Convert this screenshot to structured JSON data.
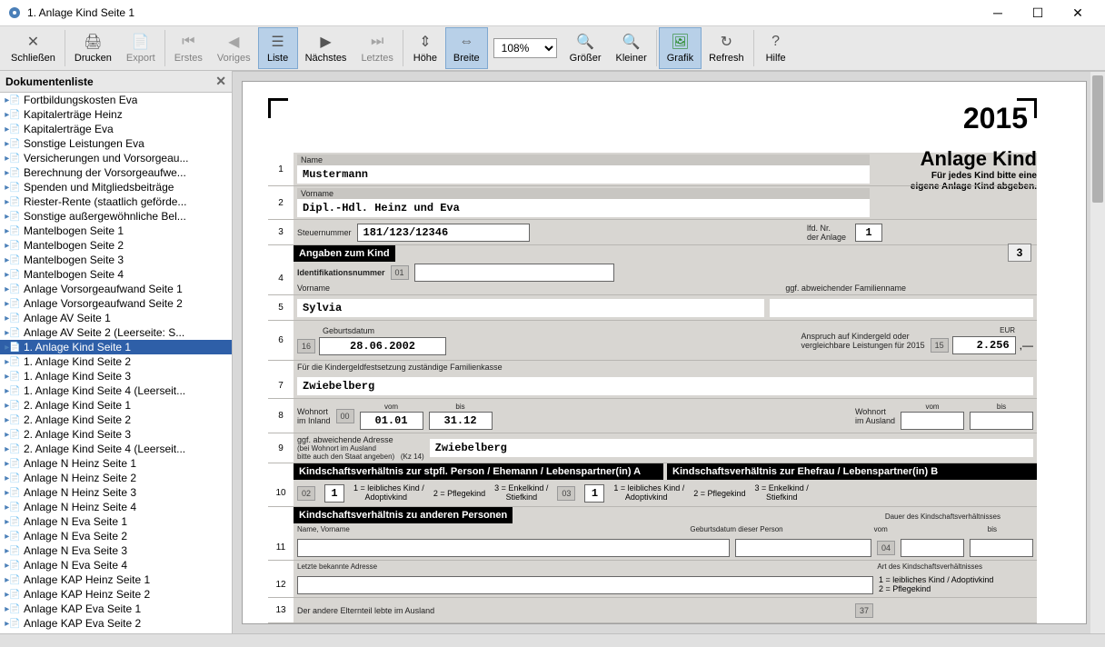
{
  "window": {
    "title": "1. Anlage Kind Seite 1"
  },
  "toolbar": {
    "schliessen": "Schließen",
    "drucken": "Drucken",
    "export": "Export",
    "erstes": "Erstes",
    "voriges": "Voriges",
    "liste": "Liste",
    "naechstes": "Nächstes",
    "letztes": "Letztes",
    "hoehe": "Höhe",
    "breite": "Breite",
    "zoom": "108%",
    "groesser": "Größer",
    "kleiner": "Kleiner",
    "grafik": "Grafik",
    "refresh": "Refresh",
    "hilfe": "Hilfe"
  },
  "sidebar": {
    "title": "Dokumentenliste",
    "items": [
      "Fortbildungskosten Eva",
      "Kapitalerträge Heinz",
      "Kapitalerträge Eva",
      "Sonstige Leistungen Eva",
      "Versicherungen und Vorsorgeau...",
      "Berechnung der Vorsorgeaufwe...",
      "Spenden und Mitgliedsbeiträge",
      "Riester-Rente (staatlich geförde...",
      "Sonstige außergewöhnliche Bel...",
      "Mantelbogen Seite 1",
      "Mantelbogen Seite 2",
      "Mantelbogen Seite 3",
      "Mantelbogen Seite 4",
      "Anlage Vorsorgeaufwand Seite 1",
      "Anlage Vorsorgeaufwand Seite 2",
      "Anlage AV Seite 1",
      "Anlage AV Seite 2 (Leerseite: S...",
      "1. Anlage Kind Seite 1",
      "1. Anlage Kind Seite 2",
      "1. Anlage Kind Seite 3",
      "1. Anlage Kind Seite 4 (Leerseit...",
      "2. Anlage Kind Seite 1",
      "2. Anlage Kind Seite 2",
      "2. Anlage Kind Seite 3",
      "2. Anlage Kind Seite 4 (Leerseit...",
      "Anlage N Heinz Seite 1",
      "Anlage N Heinz Seite 2",
      "Anlage N Heinz Seite 3",
      "Anlage N Heinz Seite 4",
      "Anlage N Eva Seite 1",
      "Anlage N Eva Seite 2",
      "Anlage N Eva Seite 3",
      "Anlage N Eva Seite 4",
      "Anlage KAP Heinz Seite 1",
      "Anlage KAP Heinz Seite 2",
      "Anlage KAP Eva Seite 1",
      "Anlage KAP Eva Seite 2"
    ],
    "selected_index": 17
  },
  "form": {
    "year": "2015",
    "title": "Anlage Kind",
    "subtitle1": "Für jedes Kind bitte eine",
    "subtitle2": "eigene Anlage Kind abgeben.",
    "name_label": "Name",
    "name": "Mustermann",
    "vorname_label": "Vorname",
    "vorname": "Dipl.-Hdl. Heinz und Eva",
    "steuernummer_label": "Steuernummer",
    "steuernummer": "181/123/12346",
    "lfd_label1": "lfd. Nr.",
    "lfd_label2": "der Anlage",
    "lfd_nr": "1",
    "box3": "3",
    "section_kind": "Angaben zum Kind",
    "ident_label": "Identifikationsnummer",
    "ident_code": "01",
    "kvorname_label": "Vorname",
    "abw_famname_label": "ggf. abweichender Familienname",
    "kind_vorname": "Sylvia",
    "gebdat_label": "Geburtsdatum",
    "gebdat_code": "16",
    "gebdat": "28.06.2002",
    "anspruch_label1": "Anspruch auf Kindergeld oder",
    "anspruch_label2": "vergleichbare Leistungen für 2015",
    "eur_label": "EUR",
    "anspruch_code": "15",
    "anspruch_betrag": "2.256",
    "famkasse_label": "Für die Kindergeldfestsetzung zuständige Familienkasse",
    "famkasse": "Zwiebelberg",
    "wohnort_inland_label": "Wohnort\nim Inland",
    "wohnort_code": "00",
    "vom_label": "vom",
    "bis_label": "bis",
    "inland_vom": "01.01",
    "inland_bis": "31.12",
    "wohnort_ausland_label": "Wohnort\nim Ausland",
    "abw_adresse_label": "ggf. abweichende Adresse",
    "abw_adresse_hint": "(bei Wohnort im Ausland\nbitte auch den Staat angeben)",
    "abw_kz": "(Kz 14)",
    "abw_adresse": "Zwiebelberg",
    "section_ksv_a": "Kindschaftsverhältnis zur stpfl. Person / Ehemann / Lebenspartner(in) A",
    "section_ksv_b": "Kindschaftsverhältnis zur Ehefrau / Lebenspartner(in) B",
    "ksv_a_code": "02",
    "ksv_a_val": "1",
    "ksv_b_code": "03",
    "ksv_b_val": "1",
    "opt1": "1 = leibliches Kind / Adoptivkind",
    "opt2": "2 = Pflegekind",
    "opt3": "3 = Enkelkind / Stiefkind",
    "section_andere": "Kindschaftsverhältnis zu anderen Personen",
    "name_vorname_label": "Name, Vorname",
    "gebdat_person_label": "Geburtsdatum dieser Person",
    "dauer_label": "Dauer des Kindschaftsverhältnisses",
    "r11_code": "04",
    "letzte_adresse_label": "Letzte bekannte Adresse",
    "art_ksv_label": "Art des Kindschaftsverhältnisses",
    "r13_label": "Der andere Elternteil lebte im Ausland",
    "r13_code": "37"
  }
}
